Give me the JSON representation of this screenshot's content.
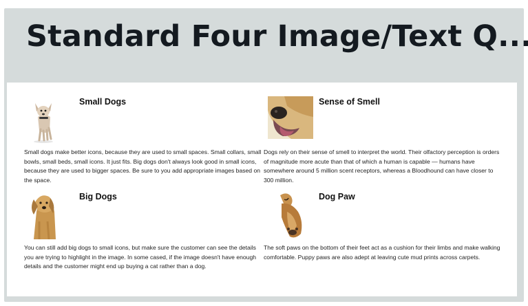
{
  "title": "Standard Four Image/Text Q...",
  "modules": [
    {
      "heading": "Small Dogs",
      "image": "chihuahua-photo",
      "text": "Small dogs make better icons, because they are used to small spaces. Small collars, small bowls, small beds, small icons. It just fits. Big dogs don't always look good in small icons, because they are used to bigger spaces. Be sure to you add appropriate images based on the space."
    },
    {
      "heading": "Sense of Smell",
      "image": "dog-nose-photo",
      "text": "Dogs rely on their sense of smell to interpret the world. Their olfactory perception is orders of magnitude more acute than that of which a human is capable — humans have somewhere around 5 million scent receptors, whereas a Bloodhound can have closer to 300 million."
    },
    {
      "heading": "Big Dogs",
      "image": "golden-retriever-photo",
      "text": "You can still add big dogs to small icons, but make sure the customer can see the details you are trying to highlight in the image. In some cased, if the image doesn't have enough details and the customer might end up buying a cat rather than a dog."
    },
    {
      "heading": "Dog Paw",
      "image": "dog-paw-photo",
      "text": "The soft paws on the bottom of their feet act as a cushion for their limbs and make walking comfortable. Puppy paws are also adept at leaving cute mud prints across carpets."
    }
  ]
}
